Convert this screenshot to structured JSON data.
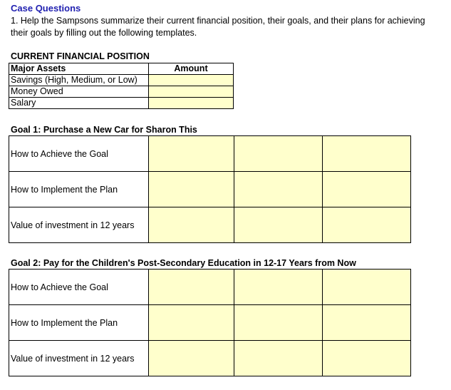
{
  "header": {
    "title": "Case Questions",
    "question": "1. Help the Sampsons summarize their current financial position, their goals, and their plans for achieving their goals by filling out the following templates."
  },
  "financial_position": {
    "heading": "CURRENT  FINANCIAL POSITION",
    "columns": [
      "Major Assets",
      "Amount"
    ],
    "rows": [
      {
        "label": "Savings (High, Medium, or Low)",
        "amount": ""
      },
      {
        "label": "Money Owed",
        "amount": ""
      },
      {
        "label": "Salary",
        "amount": ""
      }
    ]
  },
  "goals": [
    {
      "heading": "Goal 1: Purchase a New Car for Sharon This",
      "rows": [
        {
          "label": "How to Achieve the Goal",
          "cells": [
            "",
            "",
            ""
          ]
        },
        {
          "label": "How to Implement the Plan",
          "cells": [
            "",
            "",
            ""
          ]
        },
        {
          "label": "Value of investment in 12 years",
          "cells": [
            "",
            "",
            ""
          ]
        }
      ]
    },
    {
      "heading": "Goal 2: Pay for the Children's Post-Secondary Education in 12-17 Years from Now",
      "rows": [
        {
          "label": "How to Achieve the Goal",
          "cells": [
            "",
            "",
            ""
          ]
        },
        {
          "label": "How to Implement the Plan",
          "cells": [
            "",
            "",
            ""
          ]
        },
        {
          "label": "Value of investment in 12 years",
          "cells": [
            "",
            "",
            ""
          ]
        }
      ]
    }
  ],
  "colors": {
    "title": "#1f1fb0",
    "input_fill": "#ffffcc",
    "border": "#000000"
  }
}
